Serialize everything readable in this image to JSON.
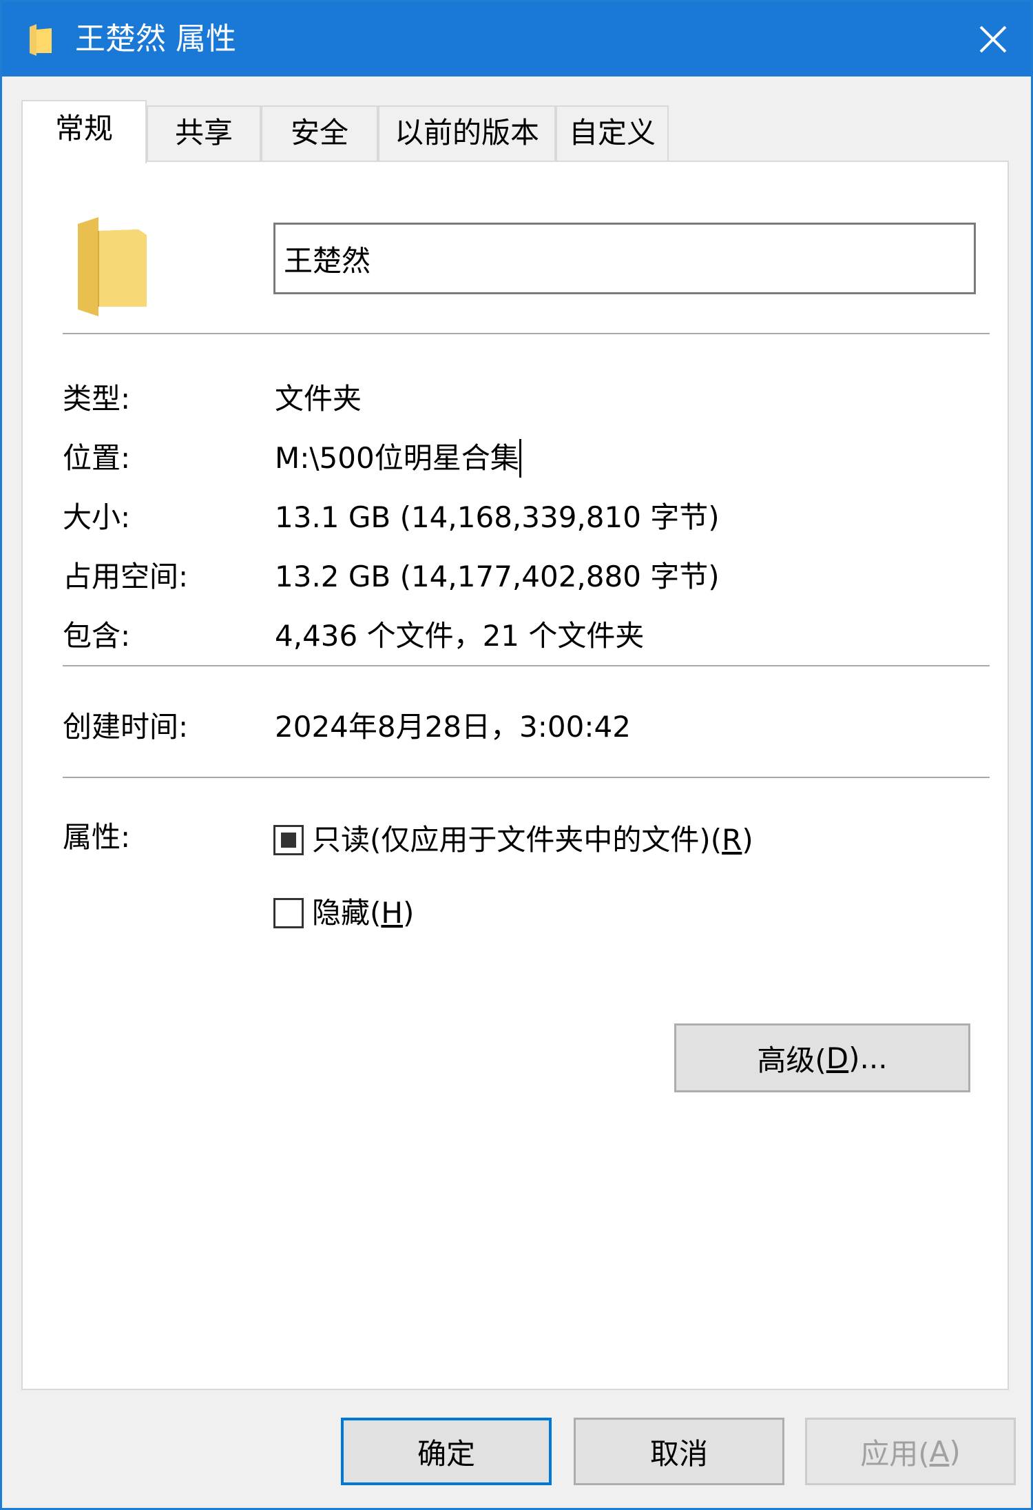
{
  "window": {
    "title": "王楚然 属性"
  },
  "tabs": [
    "常规",
    "共享",
    "安全",
    "以前的版本",
    "自定义"
  ],
  "name_field": {
    "value": "王楚然"
  },
  "info": {
    "type_label": "类型:",
    "type_value": "文件夹",
    "location_label": "位置:",
    "location_value": "M:\\500位明星合集",
    "size_label": "大小:",
    "size_value": "13.1 GB (14,168,339,810 字节)",
    "disk_label": "占用空间:",
    "disk_value": "13.2 GB (14,177,402,880 字节)",
    "contains_label": "包含:",
    "contains_value": "4,436 个文件，21 个文件夹",
    "created_label": "创建时间:",
    "created_value": "2024年8月28日，3:00:42"
  },
  "attributes": {
    "label": "属性:",
    "readonly": {
      "text": "只读(仅应用于文件夹中的文件)(",
      "key": "R",
      "end": ")",
      "state": "indeterminate"
    },
    "hidden": {
      "text": "隐藏(",
      "key": "H",
      "end": ")",
      "checked": false
    },
    "advanced": {
      "text": "高级(",
      "key": "D",
      "end": ")..."
    }
  },
  "buttons": {
    "ok": "确定",
    "cancel": "取消",
    "apply": {
      "text": "应用(",
      "key": "A",
      "end": ")"
    }
  },
  "colors": {
    "titlebar": "#1a79d6",
    "folder": "#f3cc63",
    "primary_border": "#0078d7"
  }
}
